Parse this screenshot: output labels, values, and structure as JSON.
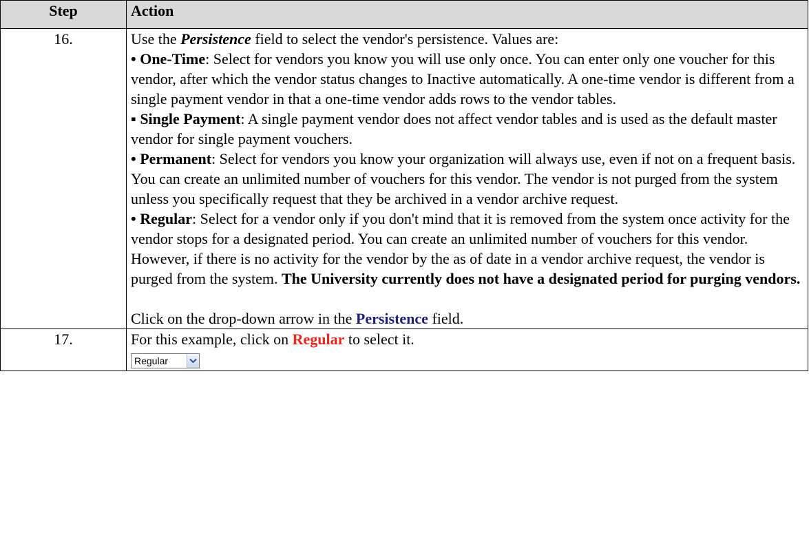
{
  "header": {
    "step": "Step",
    "action": "Action"
  },
  "rows": [
    {
      "step": "16.",
      "intro_pre": "Use the ",
      "intro_field": "Persistence",
      "intro_post": " field to select the vendor's persistence. Values are:",
      "items": [
        {
          "bullet": "•",
          "term": "One-Time",
          "text": ": Select for vendors you know you will use only once. You can enter only one voucher for this vendor, after which the vendor status changes to Inactive automatically. A one-time vendor is different from a single payment vendor in that a one-time vendor adds rows to the vendor tables."
        },
        {
          "bullet": "▪",
          "term": "Single Payment",
          "text": ": A single payment vendor does not affect vendor tables and is used as the default master vendor for single payment vouchers."
        },
        {
          "bullet": "•",
          "term": "Permanent",
          "text": ": Select for vendors you know your organization will always use, even if not on a frequent basis. You can create an unlimited number of vouchers for this vendor. The vendor is not purged from the system unless you specifically request that they be archived in a vendor archive request."
        },
        {
          "bullet": "•",
          "term": "Regular",
          "text": ": Select for a vendor only if you don't mind that it is removed from the system once activity for the vendor stops for a designated period. You can create an unlimited number of vouchers for this vendor. However, if there is no activity for the vendor by the as of date in a vendor archive request, the vendor is purged from the system. ",
          "emphasis": "The University currently does not have a designated period for purging vendors."
        }
      ],
      "instruction_pre": "Click on the drop-down arrow in the ",
      "instruction_field": "Persistence",
      "instruction_post": " field."
    },
    {
      "step": "17.",
      "text_pre": "For this example, click on ",
      "text_value": "Regular",
      "text_post": " to select it.",
      "dropdown_value": "Regular",
      "dropdown_icon": "chevron-down-icon"
    }
  ]
}
